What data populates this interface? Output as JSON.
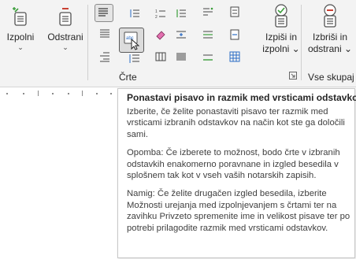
{
  "ribbon": {
    "buttons": {
      "fill": {
        "label": "Izpolni",
        "icon": "fill-list-icon"
      },
      "remove": {
        "label": "Odstrani",
        "icon": "remove-list-icon"
      },
      "print_fill": {
        "label1": "Izpiši in",
        "label2": "izpolni",
        "icon": "print-fill-icon"
      },
      "erase_remove": {
        "label1": "Izbriši in",
        "label2": "odstrani",
        "icon": "erase-remove-icon"
      }
    },
    "groups": {
      "lines": "Črte",
      "all_together": "Vse skupaj"
    },
    "chevron": "⌄",
    "accent_green": "#3a9d3a",
    "accent_red": "#c42b1c",
    "accent_blue": "#2b6cc4"
  },
  "tooltip": {
    "title": "Ponastavi pisavo in razmik med vrsticami odstavkov",
    "paragraphs": [
      "Izberite, če želite ponastaviti pisavo ter razmik med vrsticami izbranih odstavkov na način kot ste ga določili sami.",
      "Opomba: Če izberete to možnost, bodo črte v izbranih odstavkih enakomerno poravnane in izgled besedila v splošnem tak kot v vseh vaših notarskih zapisih.",
      "Namig: Če želite drugačen izgled besedila, izberite Možnosti urejanja med izpolnjevanjem s črtami ter na zavihku Privzeto spremenite ime in velikost pisave ter po potrebi prilagodite razmik med vrsticami odstavkov."
    ]
  }
}
